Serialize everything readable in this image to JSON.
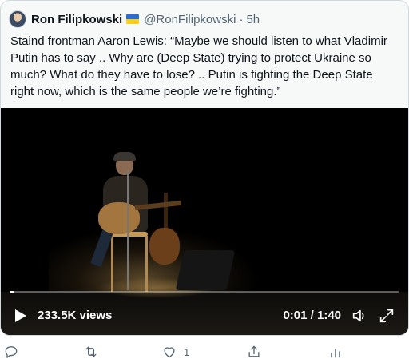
{
  "tweet": {
    "author_name": "Ron Filipkowski",
    "handle": "@RonFilipkowski",
    "separator": "·",
    "time": "5h",
    "text": "Staind frontman Aaron Lewis: “Maybe we should listen to what Vladimir\nPutin has to say .. Why are (Deep State) trying to protect Ukraine so\nmuch? What do they have to lose? .. Putin is fighting the Deep State\nright now, which is the same people we’re fighting.”",
    "flag_colors": {
      "top": "#2a6ed1",
      "bottom": "#f5cf1d"
    }
  },
  "video": {
    "views": "233.5K views",
    "timecode": "0:01 / 1:40",
    "progress": 0.01,
    "icons": [
      "play-icon",
      "volume-icon",
      "fullscreen-icon"
    ]
  },
  "actions": {
    "reply_icon": "reply-icon",
    "retweet_icon": "retweet-icon",
    "like_icon": "like-icon",
    "like_count": "1",
    "share_icon": "share-icon",
    "analytics_icon": "analytics-icon"
  },
  "colors": {
    "text": "#0f1419",
    "secondary": "#536471",
    "card_border": "#cfd9de",
    "card_bg": "#f7f9f9"
  }
}
